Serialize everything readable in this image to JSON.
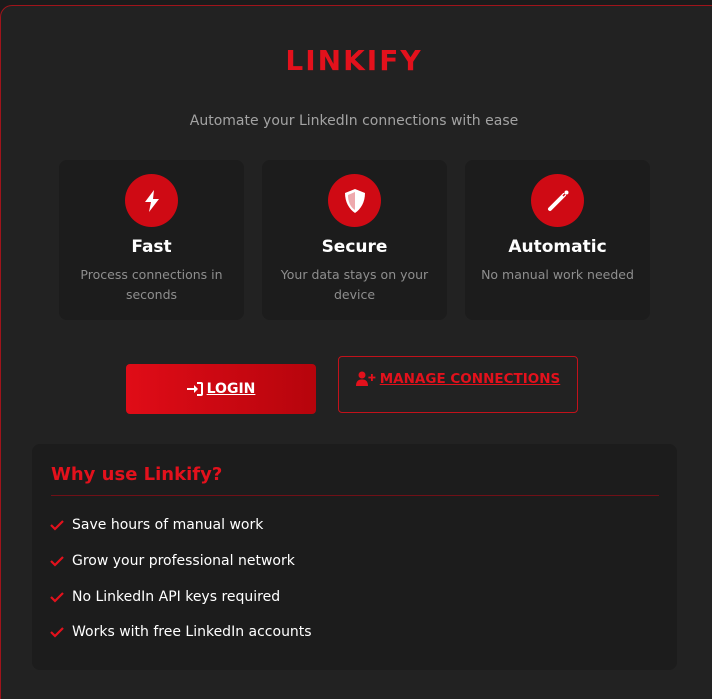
{
  "app": {
    "logo": "LINKIFY",
    "tagline": "Automate your LinkedIn connections with ease",
    "accent_color": "#e3111c"
  },
  "features": [
    {
      "icon": "lightning-bolt-icon",
      "title": "Fast",
      "description": "Process connections in seconds"
    },
    {
      "icon": "shield-icon",
      "title": "Secure",
      "description": "Your data stays on your device"
    },
    {
      "icon": "magic-wand-icon",
      "title": "Automatic",
      "description": "No manual work needed"
    }
  ],
  "actions": {
    "login_label": "LOGIN",
    "login_icon": "sign-in-icon",
    "manage_label": "MANAGE CONNECTIONS",
    "manage_icon": "user-plus-icon"
  },
  "why": {
    "title": "Why use Linkify?",
    "items": [
      "Save hours of manual work",
      "Grow your professional network",
      "No LinkedIn API keys required",
      "Works with free LinkedIn accounts"
    ]
  }
}
